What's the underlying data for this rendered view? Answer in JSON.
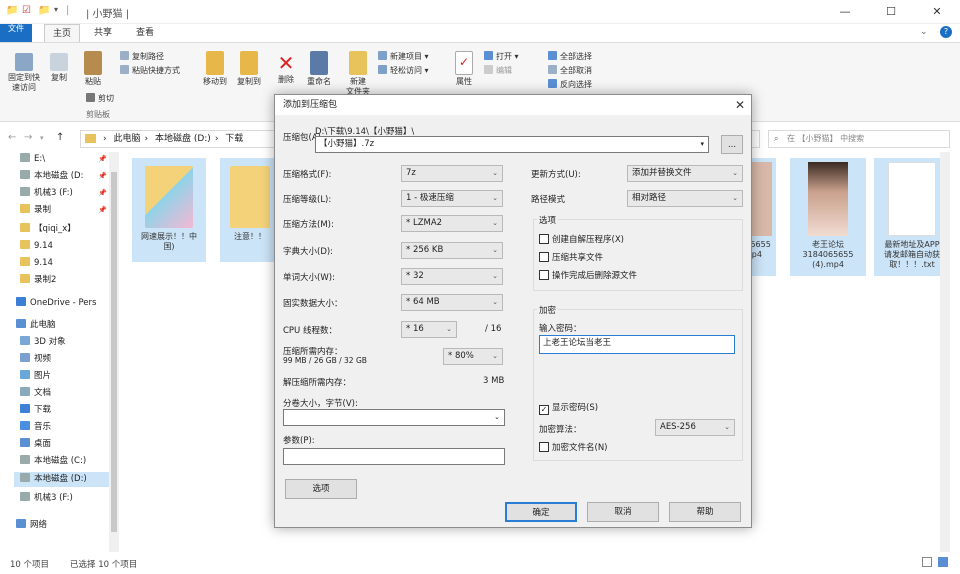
{
  "window": {
    "title": "| 小野猫 |",
    "minimize": "—",
    "maximize": "☐",
    "close": "✕",
    "help": "?"
  },
  "tabs": [
    "文件",
    "主页",
    "共享",
    "查看"
  ],
  "ribbon": {
    "pin_quick": "固定到快\n速访问",
    "copy": "复制",
    "paste": "粘贴",
    "copy_path": "复制路径",
    "paste_shortcut": "粘贴快捷方式",
    "cut": "剪切",
    "clipboard": "剪贴板",
    "move_to": "移动到",
    "copy_to": "复制到",
    "delete": "删除",
    "rename": "重命名",
    "new_folder": "新建\n文件夹",
    "new_item": "新建项目",
    "easy_access": "轻松访问",
    "properties": "属性",
    "open": "打开",
    "edit": "编辑",
    "select_all": "全部选择",
    "select_none": "全部取消",
    "invert": "反向选择"
  },
  "address": {
    "path": [
      "此电脑",
      "本地磁盘 (D:)",
      "下载"
    ],
    "search_placeholder": "在 【小野猫】 中搜索"
  },
  "nav_pane": [
    {
      "label": "E:\\",
      "pin": true
    },
    {
      "label": "本地磁盘 (D:",
      "pin": true
    },
    {
      "label": "机械3 (F:)",
      "pin": true
    },
    {
      "label": "录制",
      "pin": true
    },
    {
      "label": "【qiqi_x】",
      "pin": false
    },
    {
      "label": "9.14",
      "pin": false
    },
    {
      "label": "9.14",
      "pin": false
    },
    {
      "label": "录制2",
      "pin": false
    },
    {
      "label": "OneDrive - Pers",
      "pin": false
    },
    {
      "label": "此电脑",
      "pin": false
    },
    {
      "label": "3D 对象",
      "pin": false
    },
    {
      "label": "视频",
      "pin": false
    },
    {
      "label": "图片",
      "pin": false
    },
    {
      "label": "文档",
      "pin": false
    },
    {
      "label": "下载",
      "pin": false
    },
    {
      "label": "音乐",
      "pin": false
    },
    {
      "label": "桌面",
      "pin": false
    },
    {
      "label": "本地磁盘 (C:)",
      "pin": false
    },
    {
      "label": "本地磁盘 (D:)",
      "pin": false
    },
    {
      "label": "机械3 (F:)",
      "pin": false
    },
    {
      "label": "网络",
      "pin": false
    }
  ],
  "files": [
    {
      "name": "网速展示！！中\n国)"
    },
    {
      "name": "注意！！"
    },
    {
      "name": "4065655\nmp4"
    },
    {
      "name": "老王论坛\n3184065655\n(4).mp4"
    },
    {
      "name": "最新地址及APP\n请发邮箱自动获\n取！！！.txt"
    }
  ],
  "status": {
    "count": "10 个项目",
    "selected": "已选择 10 个项目"
  },
  "dialog": {
    "title": "添加到压缩包",
    "close": "✕",
    "archive_label": "压缩包(A)",
    "archive_dir": "D:\\下载\\9.14\\【小野猫】\\",
    "archive_name": "【小野猫】.7z",
    "browse": "...",
    "format_label": "压缩格式(F):",
    "format_value": "7z",
    "level_label": "压缩等级(L):",
    "level_value": "1 - 极速压缩",
    "method_label": "压缩方法(M):",
    "method_value": "* LZMA2",
    "dict_label": "字典大小(D):",
    "dict_value": "* 256 KB",
    "word_label": "单词大小(W):",
    "word_value": "* 32",
    "solid_label": "固实数据大小：",
    "solid_value": "* 64 MB",
    "cpu_label": "CPU 线程数：",
    "cpu_value": "* 16",
    "cpu_total": "/ 16",
    "mem_label": "压缩所需内存：",
    "mem_detail": "99 MB / 26 GB / 32 GB",
    "mem_value": "* 80%",
    "dmem_label": "解压缩所需内存：",
    "dmem_value": "3 MB",
    "split_label": "分卷大小，字节(V):",
    "params_label": "参数(P):",
    "options_btn": "选项",
    "update_label": "更新方式(U):",
    "update_value": "添加并替换文件",
    "path_label": "路径模式",
    "path_value": "相对路径",
    "opts_group": "选项",
    "opt_sfx": "创建自解压程序(X)",
    "opt_shared": "压缩共享文件",
    "opt_delete": "操作完成后删除源文件",
    "enc_group": "加密",
    "pw_label": "输入密码：",
    "pw_value": "上老王论坛当老王",
    "show_pw": "显示密码(S)",
    "enc_method_label": "加密算法：",
    "enc_method_value": "AES-256",
    "enc_names": "加密文件名(N)",
    "ok": "确定",
    "cancel": "取消",
    "help": "帮助"
  }
}
